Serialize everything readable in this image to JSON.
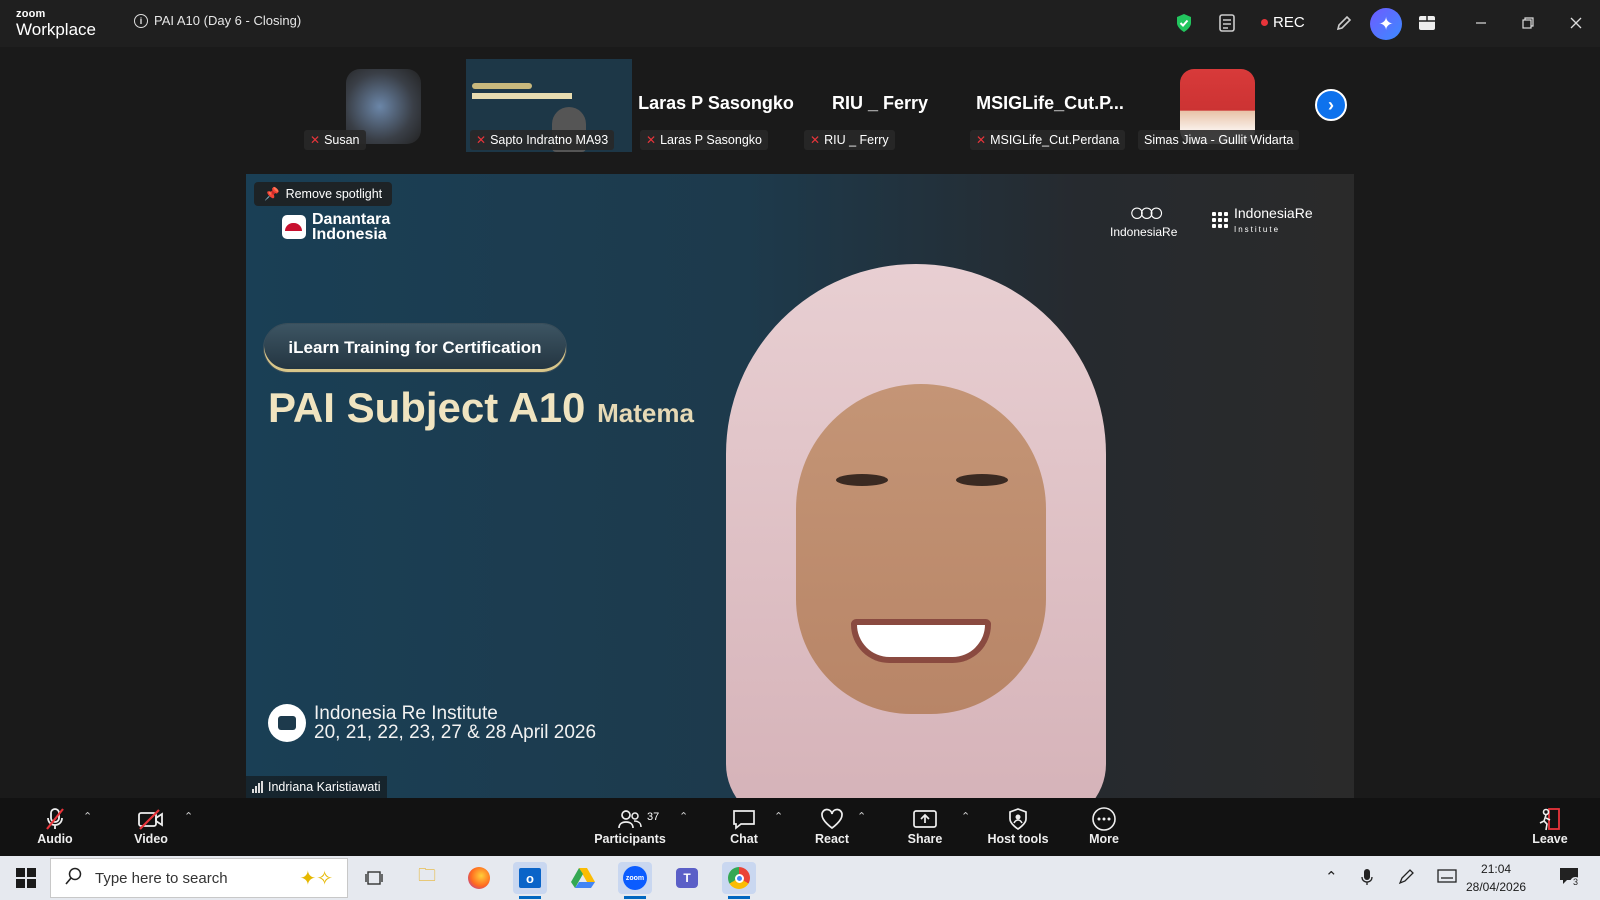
{
  "window": {
    "brand_top": "zoom",
    "brand_bottom": "Workplace",
    "meeting_title": "PAI A10 (Day 6 - Closing)",
    "rec_label": "REC"
  },
  "filmstrip": {
    "tiles": [
      {
        "name": "Susan",
        "type": "video"
      },
      {
        "name": "Sapto Indratno MA93",
        "type": "screen"
      },
      {
        "name": "Laras P Sasongko",
        "big_name": "Laras P Sasongko",
        "type": "name"
      },
      {
        "name": "RIU _ Ferry",
        "big_name": "RIU _ Ferry",
        "type": "name"
      },
      {
        "name": "MSIGLife_Cut.Perdana",
        "big_name": "MSIGLife_Cut.P...",
        "type": "name"
      },
      {
        "name": "Simas Jiwa - Gullit Widarta",
        "type": "avatar"
      }
    ]
  },
  "main": {
    "spotlight_label": "Remove spotlight",
    "logo_left_line1": "Danantara",
    "logo_left_line2": "Indonesia",
    "logo_right1": "IndonesiaRe",
    "logo_right2": "IndonesiaRe",
    "logo_right2_sub": "Institute",
    "pill_text": "iLearn Training for Certification",
    "subject_text": "PAI Subject A10",
    "subject_sub": "Matema",
    "institute_name": "Indonesia Re Institute",
    "institute_dates": "20, 21, 22, 23, 27 & 28 April 2026",
    "speaker_name": "Indriana Karistiawati"
  },
  "toolbar": {
    "audio": "Audio",
    "video": "Video",
    "participants": "Participants",
    "participants_count": "37",
    "chat": "Chat",
    "react": "React",
    "share": "Share",
    "host_tools": "Host tools",
    "more": "More",
    "leave": "Leave"
  },
  "taskbar": {
    "search_placeholder": "Type here to search",
    "time": "21:04",
    "date": "28/04/2026",
    "notification_count": "3"
  },
  "colors": {
    "accent": "#0e72ed",
    "rec": "#e8343a",
    "muted": "#e8343a"
  }
}
